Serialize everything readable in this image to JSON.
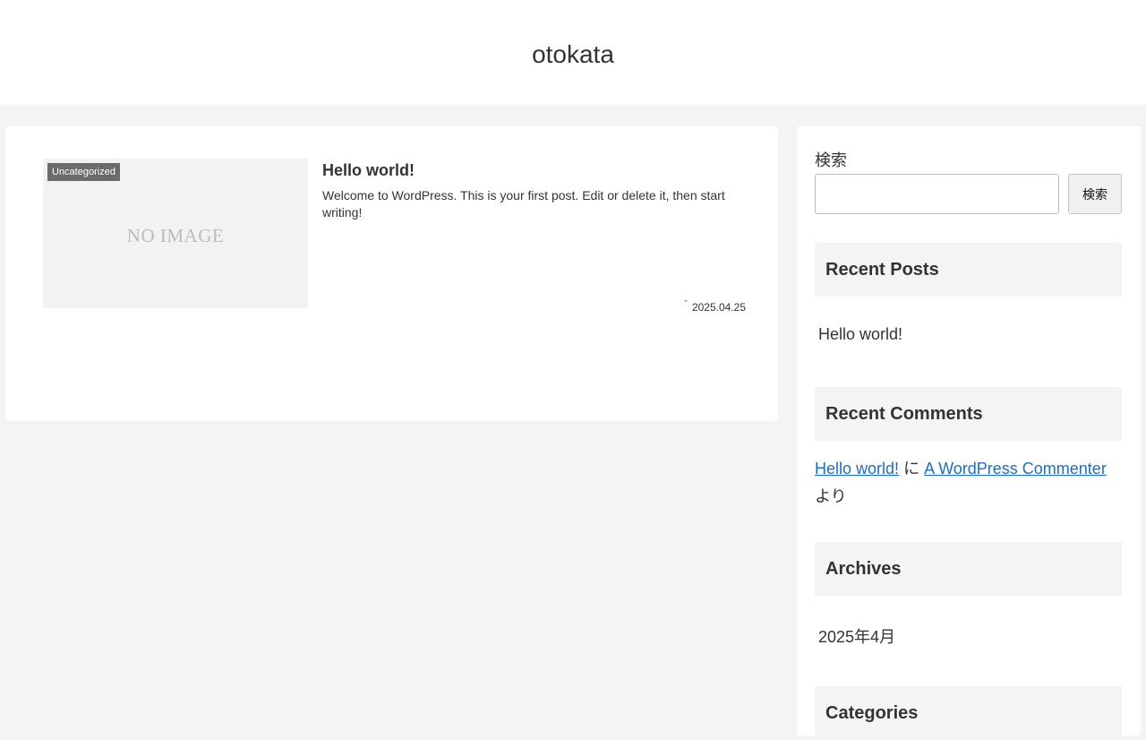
{
  "site": {
    "title": "otokata"
  },
  "post": {
    "category": "Uncategorized",
    "thumbnail_text": "NO IMAGE",
    "title": "Hello world!",
    "snippet": "Welcome to WordPress. This is your first post. Edit or delete it, then start writing!",
    "date": "2025.04.25",
    "date_icon": "clock-icon"
  },
  "sidebar": {
    "search": {
      "label": "検索",
      "button": "検索",
      "value": "",
      "placeholder": ""
    },
    "recent_posts": {
      "heading": "Recent Posts",
      "items": [
        "Hello world!"
      ]
    },
    "recent_comments": {
      "heading": "Recent Comments",
      "post_link": "Hello world!",
      "ni": "に",
      "author_link": "A WordPress Commenter",
      "yori": "より"
    },
    "archives": {
      "heading": "Archives",
      "items": [
        "2025年4月"
      ]
    },
    "categories": {
      "heading": "Categories"
    }
  },
  "colors": {
    "page_bg": "#f3f4f6",
    "link": "#1a6ec9",
    "category_badge": "#6b6b6b"
  }
}
